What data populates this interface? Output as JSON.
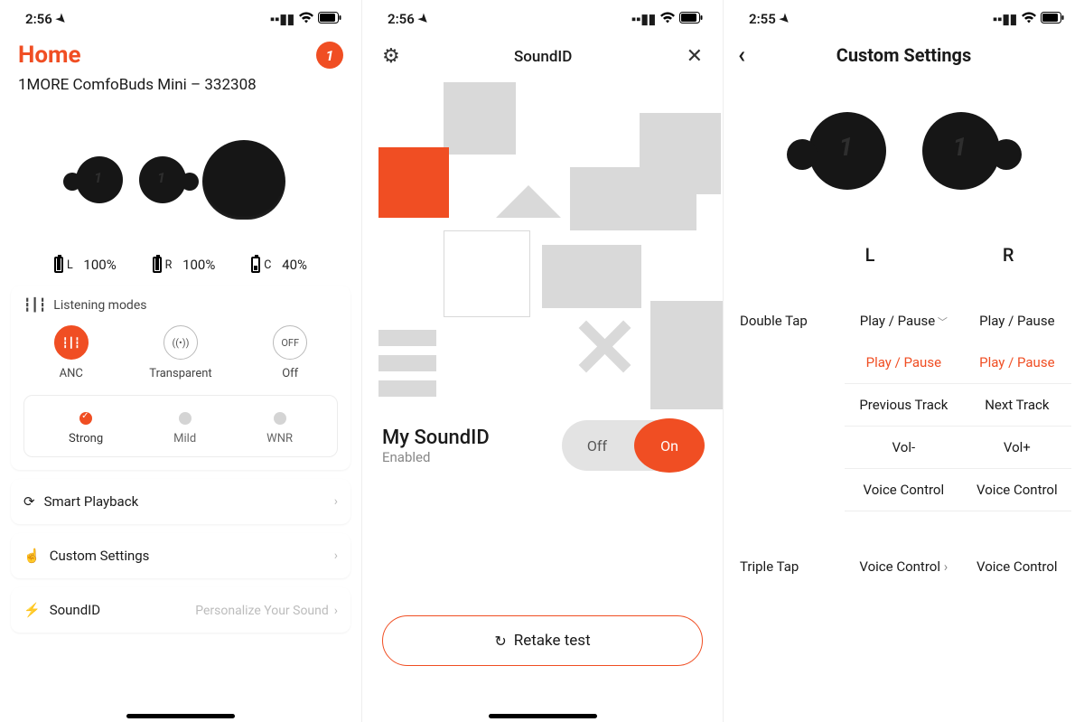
{
  "colors": {
    "accent": "#f04e23"
  },
  "status": {
    "time_s1": "2:56",
    "time_s2": "2:56",
    "time_s3": "2:55"
  },
  "screen1": {
    "title": "Home",
    "device": "1MORE ComfoBuds Mini – 332308",
    "battery": {
      "left_label": "L",
      "left_value": "100%",
      "right_label": "R",
      "right_value": "100%",
      "case_label": "C",
      "case_value": "40%",
      "case_fill_pct": 40
    },
    "listening_modes": {
      "heading": "Listening modes",
      "modes": [
        {
          "label": "ANC",
          "icon": "sound-wave",
          "active": true
        },
        {
          "label": "Transparent",
          "icon": "radio"
        },
        {
          "label": "Off",
          "icon": "OFF"
        }
      ],
      "sub_modes": [
        {
          "label": "Strong",
          "active": true
        },
        {
          "label": "Mild"
        },
        {
          "label": "WNR"
        }
      ]
    },
    "rows": {
      "smart_playback": "Smart Playback",
      "custom_settings": "Custom Settings",
      "soundid": "SoundID",
      "soundid_hint": "Personalize Your Sound"
    }
  },
  "screen2": {
    "title": "SoundID",
    "my_soundid": "My SoundID",
    "state": "Enabled",
    "toggle_off": "Off",
    "toggle_on": "On",
    "retake": "Retake test"
  },
  "screen3": {
    "title": "Custom Settings",
    "left_label": "L",
    "right_label": "R",
    "double_tap": {
      "heading": "Double Tap",
      "left_selected": "Play / Pause",
      "right_selected": "Play / Pause",
      "options_left": [
        "Play / Pause",
        "Previous Track",
        "Vol-",
        "Voice Control"
      ],
      "options_right": [
        "Play / Pause",
        "Next Track",
        "Vol+",
        "Voice Control"
      ]
    },
    "triple_tap": {
      "heading": "Triple Tap",
      "left_selected": "Voice Control",
      "right_selected": "Voice Control"
    }
  }
}
